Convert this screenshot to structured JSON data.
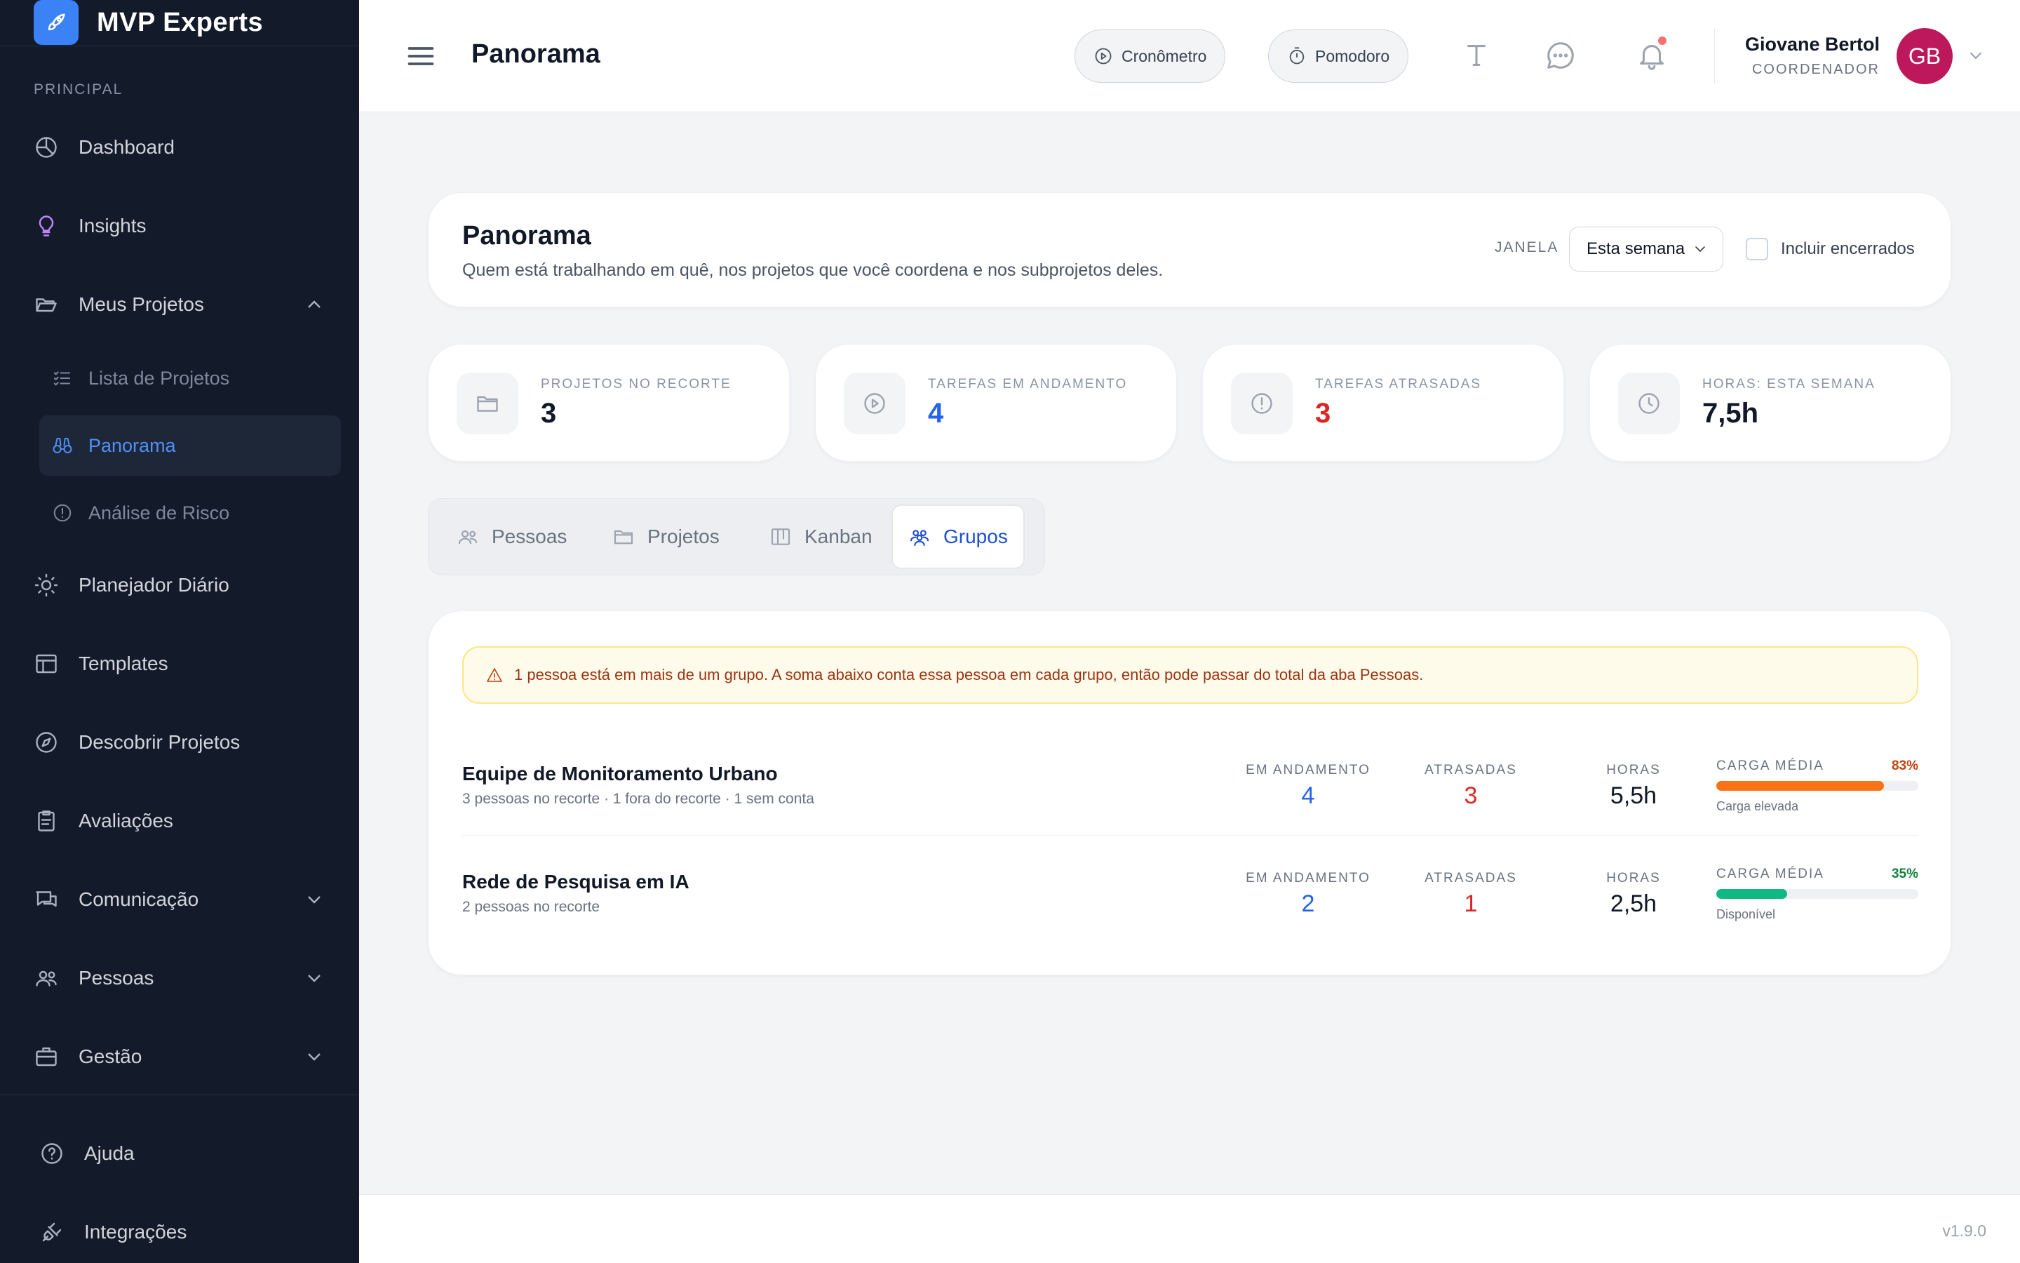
{
  "app": {
    "name": "MVP Experts"
  },
  "sidebar": {
    "section_label": "PRINCIPAL",
    "items": {
      "dashboard": "Dashboard",
      "insights": "Insights",
      "meus_projetos": "Meus Projetos",
      "lista_projetos": "Lista de Projetos",
      "panorama": "Panorama",
      "analise_risco": "Análise de Risco",
      "planejador": "Planejador Diário",
      "templates": "Templates",
      "descobrir": "Descobrir Projetos",
      "avaliacoes": "Avaliações",
      "comunicacao": "Comunicação",
      "pessoas": "Pessoas",
      "gestao": "Gestão",
      "ajuda": "Ajuda",
      "integracoes": "Integrações"
    }
  },
  "topbar": {
    "title": "Panorama",
    "cronometro": "Cronômetro",
    "pomodoro": "Pomodoro",
    "user_name": "Giovane Bertol",
    "user_role": "COORDENADOR",
    "avatar_initials": "GB"
  },
  "panorama": {
    "title": "Panorama",
    "subtitle": "Quem está trabalhando em quê, nos projetos que você coordena e nos subprojetos deles.",
    "janela_label": "JANELA",
    "janela_value": "Esta semana",
    "incluir_label": "Incluir encerrados"
  },
  "stats": [
    {
      "label": "PROJETOS NO RECORTE",
      "value": "3",
      "color": "#111827"
    },
    {
      "label": "TAREFAS EM ANDAMENTO",
      "value": "4",
      "color": "#2563eb"
    },
    {
      "label": "TAREFAS ATRASADAS",
      "value": "3",
      "color": "#dc2626"
    },
    {
      "label": "HORAS: ESTA SEMANA",
      "value": "7,5h",
      "color": "#111827"
    }
  ],
  "tabs": [
    "Pessoas",
    "Projetos",
    "Kanban",
    "Grupos"
  ],
  "active_tab": "Grupos",
  "groups": {
    "warning": "1 pessoa está em mais de um grupo. A soma abaixo conta essa pessoa em cada grupo, então pode passar do total da aba Pessoas.",
    "labels": {
      "em_andamento": "EM ANDAMENTO",
      "atrasadas": "ATRASADAS",
      "horas": "HORAS",
      "carga": "CARGA MÉDIA"
    },
    "rows": [
      {
        "name": "Equipe de Monitoramento Urbano",
        "sub": "3 pessoas no recorte · 1 fora do recorte · 1 sem conta",
        "em_andamento": "4",
        "atrasadas": "3",
        "horas": "5,5h",
        "carga_pct": "83%",
        "carga_fraction": 0.83,
        "carga_color": "#f97316",
        "pct_color": "#c2410c",
        "carga_note": "Carga elevada"
      },
      {
        "name": "Rede de Pesquisa em IA",
        "sub": "2 pessoas no recorte",
        "em_andamento": "2",
        "atrasadas": "1",
        "horas": "2,5h",
        "carga_pct": "35%",
        "carga_fraction": 0.35,
        "carga_color": "#10b981",
        "pct_color": "#15803d",
        "carga_note": "Disponível"
      }
    ]
  },
  "footer": {
    "version": "v1.9.0"
  },
  "colors": {
    "accent": "#2563eb",
    "danger": "#dc2626",
    "sidebar_bg": "#131a2a"
  }
}
